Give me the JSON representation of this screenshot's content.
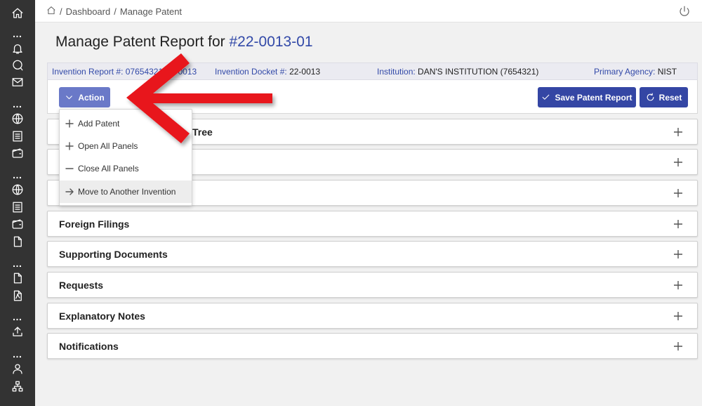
{
  "breadcrumb": {
    "home_icon": "home-icon",
    "sep": "/",
    "items": [
      "Dashboard",
      "Manage Patent"
    ]
  },
  "title": {
    "prefix": "Manage Patent Report for ",
    "number": "#22-0013-01"
  },
  "info": {
    "invention_report_label": "Invention Report #:",
    "invention_report_value": "07654321-22-0013",
    "docket_label": "Invention Docket #:",
    "docket_value": "22-0013",
    "institution_label": "Institution:",
    "institution_value": "DAN'S INSTITUTION (7654321)",
    "agency_label": "Primary Agency:",
    "agency_value": "NIST"
  },
  "actions": {
    "action_label": "Action",
    "save_label": "Save Patent Report",
    "reset_label": "Reset"
  },
  "dropdown": {
    "items": [
      {
        "label": "Add Patent",
        "icon": "plus-icon"
      },
      {
        "label": "Open All Panels",
        "icon": "plus-icon"
      },
      {
        "label": "Close All Panels",
        "icon": "minus-icon"
      },
      {
        "label": "Move to Another Invention",
        "icon": "arrow-right-icon"
      }
    ]
  },
  "panels": {
    "items": [
      {
        "label": "Tree"
      },
      {
        "label": ""
      },
      {
        "label": ""
      },
      {
        "label": "Foreign Filings"
      },
      {
        "label": "Supporting Documents"
      },
      {
        "label": "Requests"
      },
      {
        "label": "Explanatory Notes"
      },
      {
        "label": "Notifications"
      }
    ]
  },
  "colors": {
    "sidebar": "#333333",
    "accent": "#3446a4",
    "action_button": "#6a79c8",
    "link": "#3249a8",
    "annotation_arrow": "#e8141b"
  }
}
